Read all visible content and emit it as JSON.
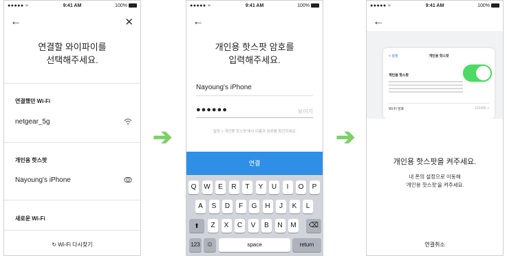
{
  "status_bar": {
    "signal": "●●●●● ≈",
    "time": "9:41 AM",
    "battery": "100%"
  },
  "screen1": {
    "back": "←",
    "close": "✕",
    "title_line1": "연결할 와이파이를",
    "title_line2": "선택해주세요.",
    "section_connected": "연결했던 Wi-Fi",
    "wifi_name": "netgear_5g",
    "wifi_icon": "wifi-icon",
    "section_hotspot": "개인용 핫스팟",
    "hotspot_name": "Nayoung's iPhone",
    "hotspot_icon": "hotspot-icon",
    "section_new": "새로운 Wi-Fi",
    "rescan_icon": "↻",
    "rescan_label": "Wi-Fi 다시찾기"
  },
  "screen2": {
    "back": "←",
    "title_line1": "개인용 핫스팟 암호를",
    "title_line2": "입력해주세요.",
    "network_name": "Nayoung's iPhone",
    "password_mask": "●●●●●●",
    "show_label": "보이기",
    "hint": "'설정 > 개인용 핫스팟'에서 이름과 암호를 확인하세요.",
    "connect_label": "연결",
    "keyboard": {
      "row1": [
        "Q",
        "W",
        "E",
        "R",
        "T",
        "Y",
        "U",
        "I",
        "O",
        "P"
      ],
      "row2": [
        "A",
        "S",
        "D",
        "F",
        "G",
        "H",
        "J",
        "K",
        "L"
      ],
      "row3": [
        "Z",
        "X",
        "C",
        "V",
        "B",
        "N",
        "M"
      ],
      "shift": "⬆",
      "delete": "⌫",
      "num": "123",
      "emoji": "☺",
      "space": "space",
      "return": "return"
    }
  },
  "screen3": {
    "back": "←",
    "settings_back": "< 설정",
    "settings_title": "개인용 핫스팟",
    "settings_row": "개인용 핫스팟",
    "wifi_pw_label": "Wi-Fi 암호",
    "wifi_pw_value": "123456 >",
    "title": "개인용 핫스팟을 켜주세요.",
    "desc_line1": "내 폰의 설정으로 이동해",
    "desc_line2": "'개인용 핫스팟'을 켜주세요.",
    "cancel_label": "연결취소"
  },
  "arrows": [
    "➔",
    "➔"
  ],
  "colors": {
    "accent_blue": "#2f8fe6",
    "arrow_green": "#7ed068",
    "toggle_green": "#4cd964"
  }
}
